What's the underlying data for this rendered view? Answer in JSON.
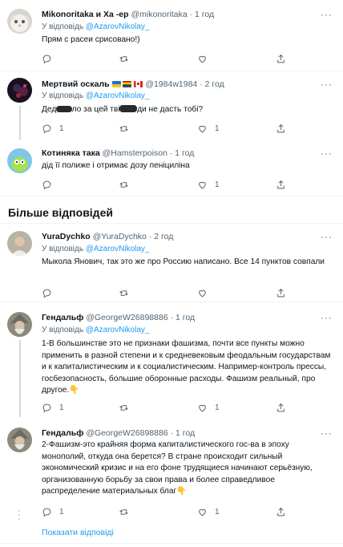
{
  "reply_prefix": "У відповідь",
  "more_label": "···",
  "section_title": "Більше відповідей",
  "show_more": "Показати відповіді",
  "tweets": [
    {
      "name": "Mikonoritaka и Xa -ep",
      "handle": "@mikonoritaka",
      "time": "1 год",
      "reply_to": "@AzarovNikolay_",
      "text": "Прям с расеи срисовано!)",
      "replies": "",
      "retweets": "",
      "likes": ""
    },
    {
      "name": "Мертвий оскаль",
      "handle": "@1984w1984",
      "time": "2 год",
      "reply_to": "@AzarovNikolay_",
      "text_parts": [
        "Дед а ",
        "ло за цей твіт ",
        "ди не дасть тобі?"
      ],
      "replies": "1",
      "retweets": "",
      "likes": "1"
    },
    {
      "name": "Котиняка така",
      "handle": "@Hamsterpoison",
      "time": "1 год",
      "text": "дід її полиже і отримає дозу пеніциліна",
      "replies": "",
      "retweets": "",
      "likes": "1"
    },
    {
      "name": "YuraDychko",
      "handle": "@YuraDychko",
      "time": "2 год",
      "reply_to": "@AzarovNikolay_",
      "text": "Мыкола Янович, так это же про Россию написано. Все 14 пунктов совпали",
      "replies": "",
      "retweets": "",
      "likes": ""
    },
    {
      "name": "Гендальф",
      "handle": "@GeorgeW26898886",
      "time": "1 год",
      "reply_to": "@AzarovNikolay_",
      "text": "1-В большинстве это не признаки фашизма, почти все пункты можно применить в разной степени и к средневековым феодальным государствам и к капиталистическим и к социалистическим. Например-контроль прессы, госбезопасность, большие оборонные расходы. Фашизм реальный, про другое.👇",
      "replies": "1",
      "retweets": "",
      "likes": "1"
    },
    {
      "name": "Гендальф",
      "handle": "@GeorgeW26898886",
      "time": "1 год",
      "text": "2-Фашизм-это крайняя форма капиталистического гос-ва в эпоху монополий, откуда она берется? В стране происходит сильный экономический кризис и на его фоне трудящиеся начинают серьёзную, организованную борьбу за свои права и более справедливое распределение материальных благ👇",
      "replies": "1",
      "retweets": "",
      "likes": "1"
    }
  ],
  "colors": {
    "accent": "#1d9bf0",
    "secondary": "#536471",
    "separator": "#eff3f4"
  }
}
